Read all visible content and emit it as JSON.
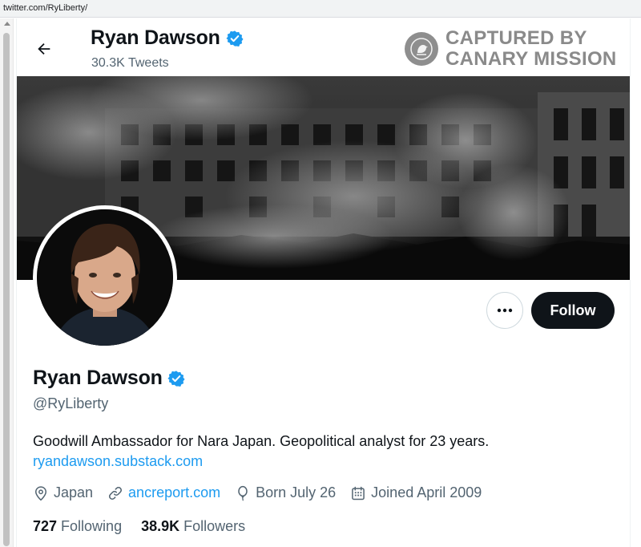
{
  "browser": {
    "url": "twitter.com/RyLiberty/"
  },
  "header": {
    "name": "Ryan Dawson",
    "tweet_count": "30.3K Tweets"
  },
  "watermark": {
    "line1": "CAPTURED BY",
    "line2": "CANARY MISSION"
  },
  "actions": {
    "more_label": "•••",
    "follow_label": "Follow"
  },
  "profile": {
    "name": "Ryan Dawson",
    "handle": "@RyLiberty",
    "bio": "Goodwill Ambassador for Nara Japan. Geopolitical analyst for 23 years.",
    "bio_link": "ryandawson.substack.com",
    "location": "Japan",
    "website": "ancreport.com",
    "born": "Born July 26",
    "joined": "Joined April 2009"
  },
  "stats": {
    "following_count": "727",
    "following_label": "Following",
    "followers_count": "38.9K",
    "followers_label": "Followers"
  },
  "colors": {
    "accent": "#1d9bf0",
    "text_primary": "#0f1419",
    "text_secondary": "#536471",
    "button_dark": "#0f1419"
  },
  "icons": {
    "back": "arrow-left-icon",
    "verified": "verified-badge-icon",
    "location": "location-pin-icon",
    "link": "link-icon",
    "birthday": "balloon-icon",
    "joined": "calendar-icon",
    "more": "more-dots-icon"
  }
}
